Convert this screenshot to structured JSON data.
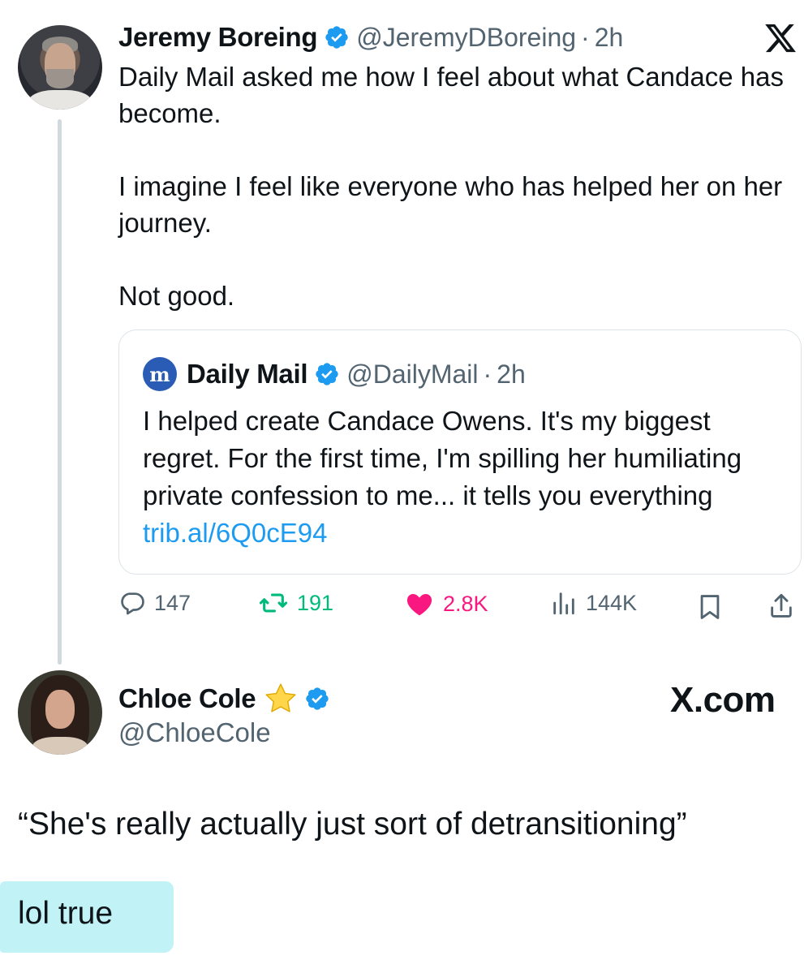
{
  "tweet": {
    "author_name": "Jeremy Boreing",
    "author_handle": "@JeremyDBoreing",
    "separator": "·",
    "time": "2h",
    "text": "Daily Mail asked me how I feel about what Candace has become.\n\nI imagine I feel like everyone who has helped her on her journey.\n\nNot good.",
    "platform_icon": "x-logo-icon",
    "quoted": {
      "author_name": "Daily Mail",
      "author_handle": "@DailyMail",
      "separator": "·",
      "time": "2h",
      "logo_glyph": "m",
      "text": "I helped create Candace Owens. It's my biggest regret. For the first time, I'm spilling her humiliating private confession to me... it tells you everything ",
      "link": "trib.al/6Q0cE94"
    },
    "actions": {
      "replies": "147",
      "reposts": "191",
      "likes": "2.8K",
      "views": "144K"
    }
  },
  "reply": {
    "author_name": "Chloe Cole",
    "author_handle": "@ChloeCole",
    "site_label": "X.com",
    "quote": "“She's really actually just sort of detransitioning”",
    "comment": "lol true"
  },
  "colors": {
    "verified": "#1d9bf0",
    "repost": "#00ba7c",
    "like": "#f91880",
    "muted": "#536471",
    "highlight": "#bdf1f5"
  }
}
